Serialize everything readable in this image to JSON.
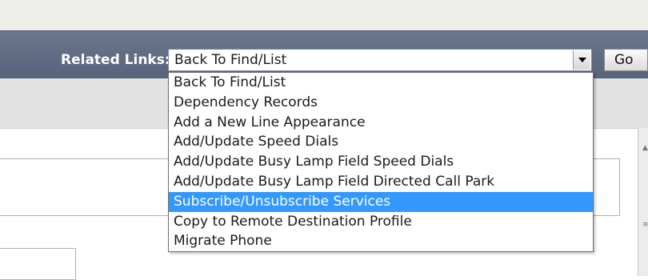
{
  "header": {
    "related_links_label": "Related Links:",
    "select_value": "Back To Find/List",
    "go_label": "Go"
  },
  "dropdown": {
    "items": [
      {
        "label": "Back To Find/List"
      },
      {
        "label": "Dependency Records"
      },
      {
        "label": "Add a New Line Appearance"
      },
      {
        "label": "Add/Update Speed Dials"
      },
      {
        "label": "Add/Update Busy Lamp Field Speed Dials"
      },
      {
        "label": "Add/Update Busy Lamp Field Directed Call Park"
      },
      {
        "label": "Subscribe/Unsubscribe Services"
      },
      {
        "label": "Copy to Remote Destination Profile"
      },
      {
        "label": "Migrate Phone"
      }
    ],
    "highlighted_index": 6,
    "highlight_color": "#3399ff"
  },
  "colors": {
    "header_bar": "#5f6c82",
    "top_strip": "#eeeeea",
    "sub_bar": "#e2e2e2"
  }
}
